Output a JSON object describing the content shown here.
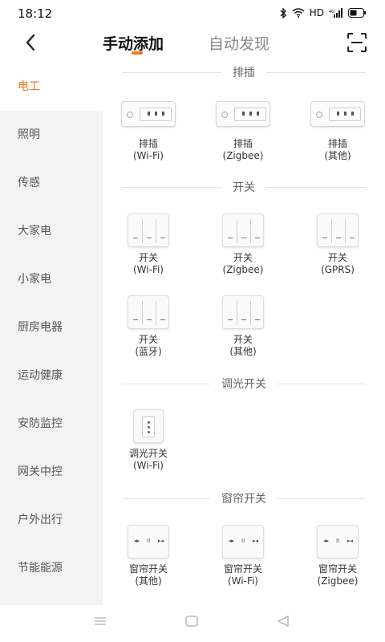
{
  "status": {
    "time": "18:12",
    "network": "HD",
    "signal": "4G"
  },
  "header": {
    "tabs": [
      {
        "label": "手动添加"
      },
      {
        "label": "自动发现"
      }
    ]
  },
  "sidebar": {
    "items": [
      {
        "label": "电工"
      },
      {
        "label": "照明"
      },
      {
        "label": "传感"
      },
      {
        "label": "大家电"
      },
      {
        "label": "小家电"
      },
      {
        "label": "厨房电器"
      },
      {
        "label": "运动健康"
      },
      {
        "label": "安防监控"
      },
      {
        "label": "网关中控"
      },
      {
        "label": "户外出行"
      },
      {
        "label": "节能能源"
      }
    ]
  },
  "sections": [
    {
      "title": "排插",
      "devices": [
        {
          "name": "排插",
          "sub": "(Wi-Fi)"
        },
        {
          "name": "排插",
          "sub": "(Zigbee)"
        },
        {
          "name": "排插",
          "sub": "(其他)"
        }
      ]
    },
    {
      "title": "开关",
      "devices": [
        {
          "name": "开关",
          "sub": "(Wi-Fi)"
        },
        {
          "name": "开关",
          "sub": "(Zigbee)"
        },
        {
          "name": "开关",
          "sub": "(GPRS)"
        },
        {
          "name": "开关",
          "sub": "(蓝牙)"
        },
        {
          "name": "开关",
          "sub": "(其他)"
        }
      ]
    },
    {
      "title": "调光开关",
      "devices": [
        {
          "name": "调光开关",
          "sub": "(Wi-Fi)"
        }
      ]
    },
    {
      "title": "窗帘开关",
      "devices": [
        {
          "name": "窗帘开关",
          "sub": "(其他)"
        },
        {
          "name": "窗帘开关",
          "sub": "(Wi-Fi)"
        },
        {
          "name": "窗帘开关",
          "sub": "(Zigbee)"
        }
      ]
    }
  ],
  "colors": {
    "accent": "#f07a1e",
    "sidebar_bg": "#f3f3f3"
  },
  "icons": {
    "back": "chevron-left-icon",
    "scan": "scan-icon"
  }
}
